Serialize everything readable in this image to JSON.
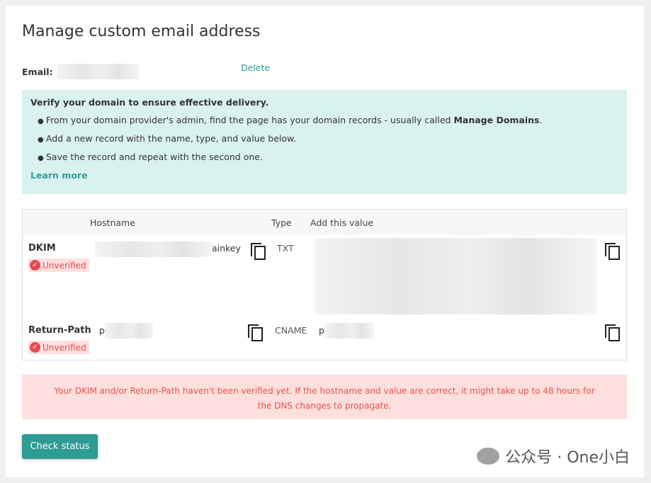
{
  "page": {
    "title": "Manage custom email address"
  },
  "email": {
    "label": "Email:",
    "delete_label": "Delete"
  },
  "info": {
    "heading": "Verify your domain to ensure effective delivery.",
    "bullets": [
      {
        "text": "From your domain provider's admin, find the page has your domain records - usually called ",
        "bold": "Manage Domains",
        "end": "."
      },
      {
        "text": "Add a new record with the name, type, and value below."
      },
      {
        "text": "Save the record and repeat with the second one."
      }
    ],
    "learn_more": "Learn more"
  },
  "table": {
    "headers": {
      "hostname": "Hostname",
      "type": "Type",
      "value": "Add this value"
    },
    "rows": [
      {
        "name": "DKIM",
        "status": "Unverified",
        "hostname_suffix": "ainkey",
        "type": "TXT",
        "value_prefix": ""
      },
      {
        "name": "Return-Path",
        "status": "Unverified",
        "hostname_prefix": "p",
        "type": "CNAME",
        "value_prefix": "p"
      }
    ]
  },
  "error": "Your DKIM and/or Return-Path haven't been verified yet. If the hostname and value are correct, it might take up to 48 hours for the DNS changes to propagate.",
  "check_status": "Check status",
  "watermark": "公众号 · One小白",
  "colors": {
    "accent": "#2e9b94",
    "error": "#e8504a",
    "info_bg": "#d9f2f0"
  }
}
